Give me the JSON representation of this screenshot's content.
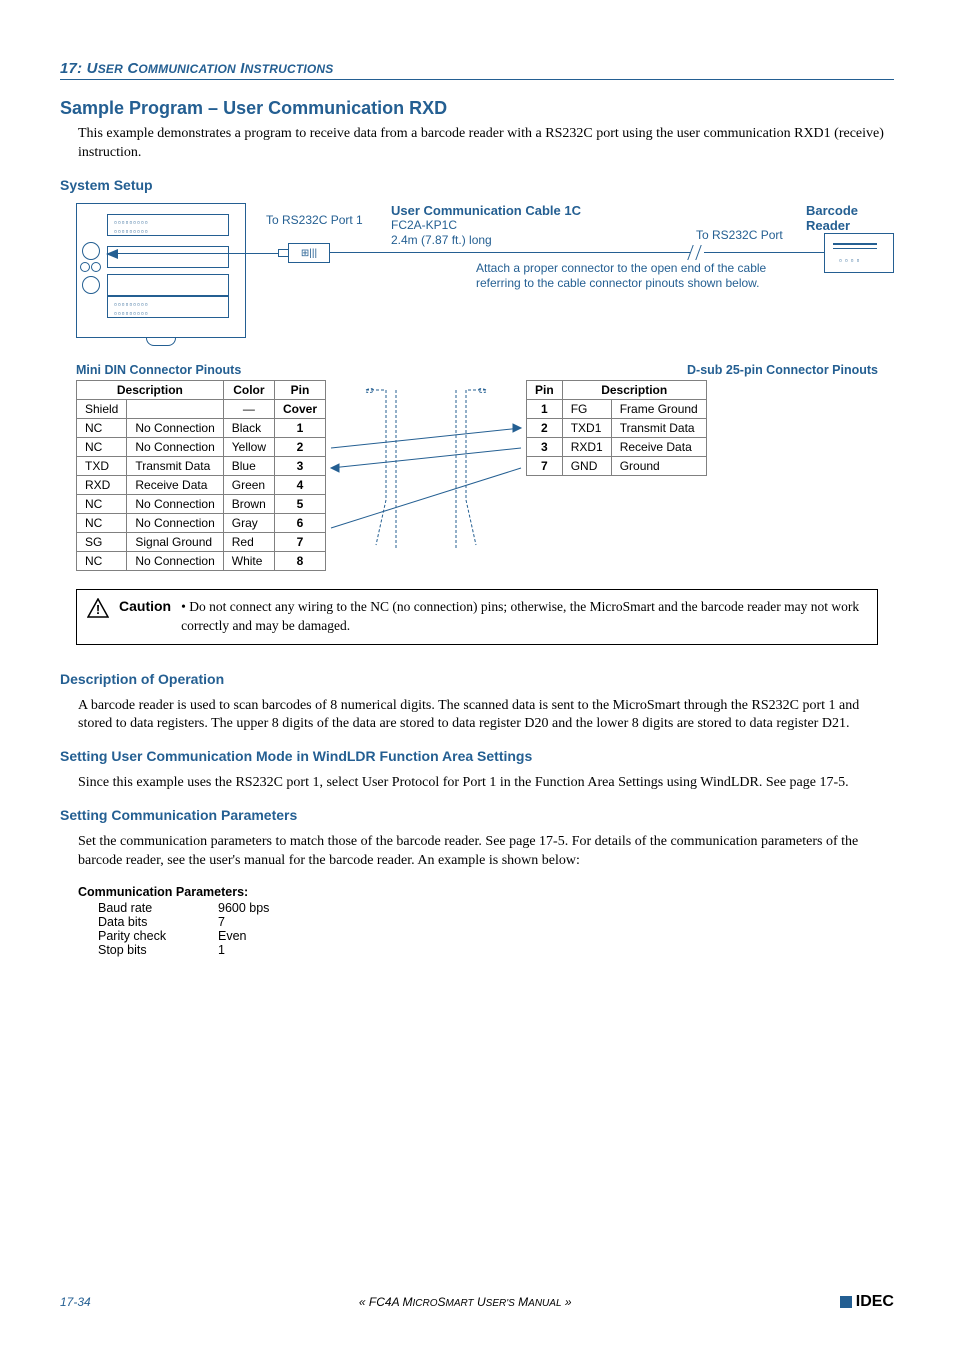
{
  "header": {
    "chapter_num": "17:",
    "chapter_title_1": "User Communication",
    "chapter_title_2": "Instructions"
  },
  "main_title": "Sample Program – User Communication RXD",
  "intro": "This example demonstrates a program to receive data from a barcode reader with a RS232C port using the user communication RXD1 (receive) instruction.",
  "system_setup_title": "System Setup",
  "diagram": {
    "to_port1": "To RS232C Port 1",
    "cable_title": "User Communication Cable 1C",
    "cable_pn": "FC2A-KP1C",
    "cable_len": "2.4m (7.87 ft.) long",
    "to_port": "To RS232C Port",
    "barcode_title": "Barcode Reader",
    "note": "Attach a proper connector to the open end of the cable referring to the cable connector pinouts shown below."
  },
  "pinouts": {
    "left_title": "Mini DIN Connector Pinouts",
    "right_title": "D-sub 25-pin Connector Pinouts",
    "left_headers": {
      "desc": "Description",
      "color": "Color",
      "pin": "Pin"
    },
    "right_headers": {
      "pin": "Pin",
      "desc": "Description"
    },
    "left_rows": [
      {
        "k": "Shield",
        "d": "",
        "c": "—",
        "p": "Cover"
      },
      {
        "k": "NC",
        "d": "No Connection",
        "c": "Black",
        "p": "1"
      },
      {
        "k": "NC",
        "d": "No Connection",
        "c": "Yellow",
        "p": "2"
      },
      {
        "k": "TXD",
        "d": "Transmit Data",
        "c": "Blue",
        "p": "3"
      },
      {
        "k": "RXD",
        "d": "Receive Data",
        "c": "Green",
        "p": "4"
      },
      {
        "k": "NC",
        "d": "No Connection",
        "c": "Brown",
        "p": "5"
      },
      {
        "k": "NC",
        "d": "No Connection",
        "c": "Gray",
        "p": "6"
      },
      {
        "k": "SG",
        "d": "Signal Ground",
        "c": "Red",
        "p": "7"
      },
      {
        "k": "NC",
        "d": "No Connection",
        "c": "White",
        "p": "8"
      }
    ],
    "right_rows": [
      {
        "p": "1",
        "k": "FG",
        "d": "Frame Ground"
      },
      {
        "p": "2",
        "k": "TXD1",
        "d": "Transmit Data"
      },
      {
        "p": "3",
        "k": "RXD1",
        "d": "Receive Data"
      },
      {
        "p": "7",
        "k": "GND",
        "d": "Ground"
      }
    ]
  },
  "caution": {
    "label": "Caution",
    "text": "• Do not connect any wiring to the NC (no connection) pins; otherwise, the MicroSmart and the barcode reader may not work correctly and may be damaged."
  },
  "desc_op": {
    "title": "Description of Operation",
    "body": "A barcode reader is used to scan barcodes of 8 numerical digits. The scanned data is sent to the MicroSmart through the RS232C port 1 and stored to data registers. The upper 8 digits of the data are stored to data register D20 and the lower 8 digits are stored to data register D21."
  },
  "setting_mode": {
    "title": "Setting User Communication Mode in WindLDR Function Area Settings",
    "body": "Since this example uses the RS232C port 1, select User Protocol for Port 1 in the Function Area Settings using WindLDR. See page 17-5."
  },
  "setting_comm": {
    "title": "Setting Communication Parameters",
    "body": "Set the communication parameters to match those of the barcode reader. See page 17-5. For details of the communication parameters of the barcode reader, see the user's manual for the barcode reader. An example is shown below:"
  },
  "comm_params": {
    "heading": "Communication Parameters:",
    "rows": [
      {
        "k": "Baud rate",
        "v": "9600 bps"
      },
      {
        "k": "Data bits",
        "v": "7"
      },
      {
        "k": "Parity check",
        "v": "Even"
      },
      {
        "k": "Stop bits",
        "v": "1"
      }
    ]
  },
  "footer": {
    "page": "17-34",
    "mid": "« FC4A MicroSmart User's Manual »",
    "logo": "IDEC"
  }
}
